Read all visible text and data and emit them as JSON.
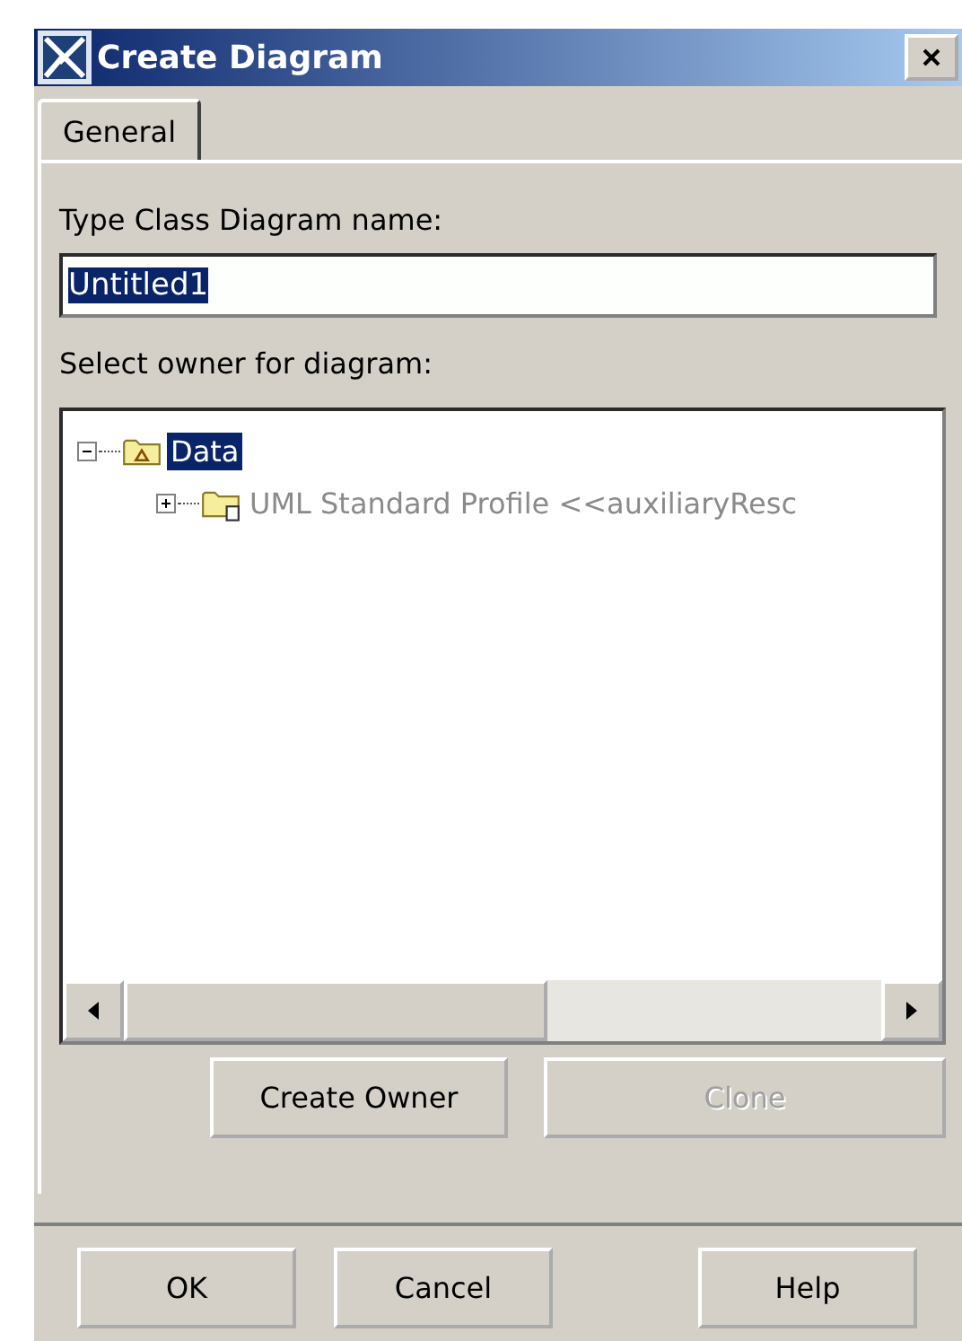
{
  "window": {
    "title": "Create Diagram"
  },
  "tabs": [
    {
      "label": "General",
      "selected": true
    }
  ],
  "name_field": {
    "label": "Type Class Diagram name:",
    "value": "Untitled1",
    "text_selected": true
  },
  "owner_tree": {
    "label": "Select owner for diagram:",
    "items": [
      {
        "label": "Data",
        "kind": "model",
        "expanded": true,
        "selected": true,
        "disabled": false,
        "children": [
          {
            "label": "UML Standard Profile <<auxiliaryResc",
            "kind": "profile",
            "expanded": false,
            "selected": false,
            "disabled": true,
            "has_children": true
          }
        ]
      }
    ]
  },
  "tree_buttons": [
    {
      "label": "Create Owner",
      "disabled": false
    },
    {
      "label": "Clone",
      "disabled": true
    }
  ],
  "buttons": [
    {
      "label": "OK",
      "disabled": false
    },
    {
      "label": "Cancel",
      "disabled": false
    },
    {
      "label": "Help",
      "disabled": false
    }
  ]
}
